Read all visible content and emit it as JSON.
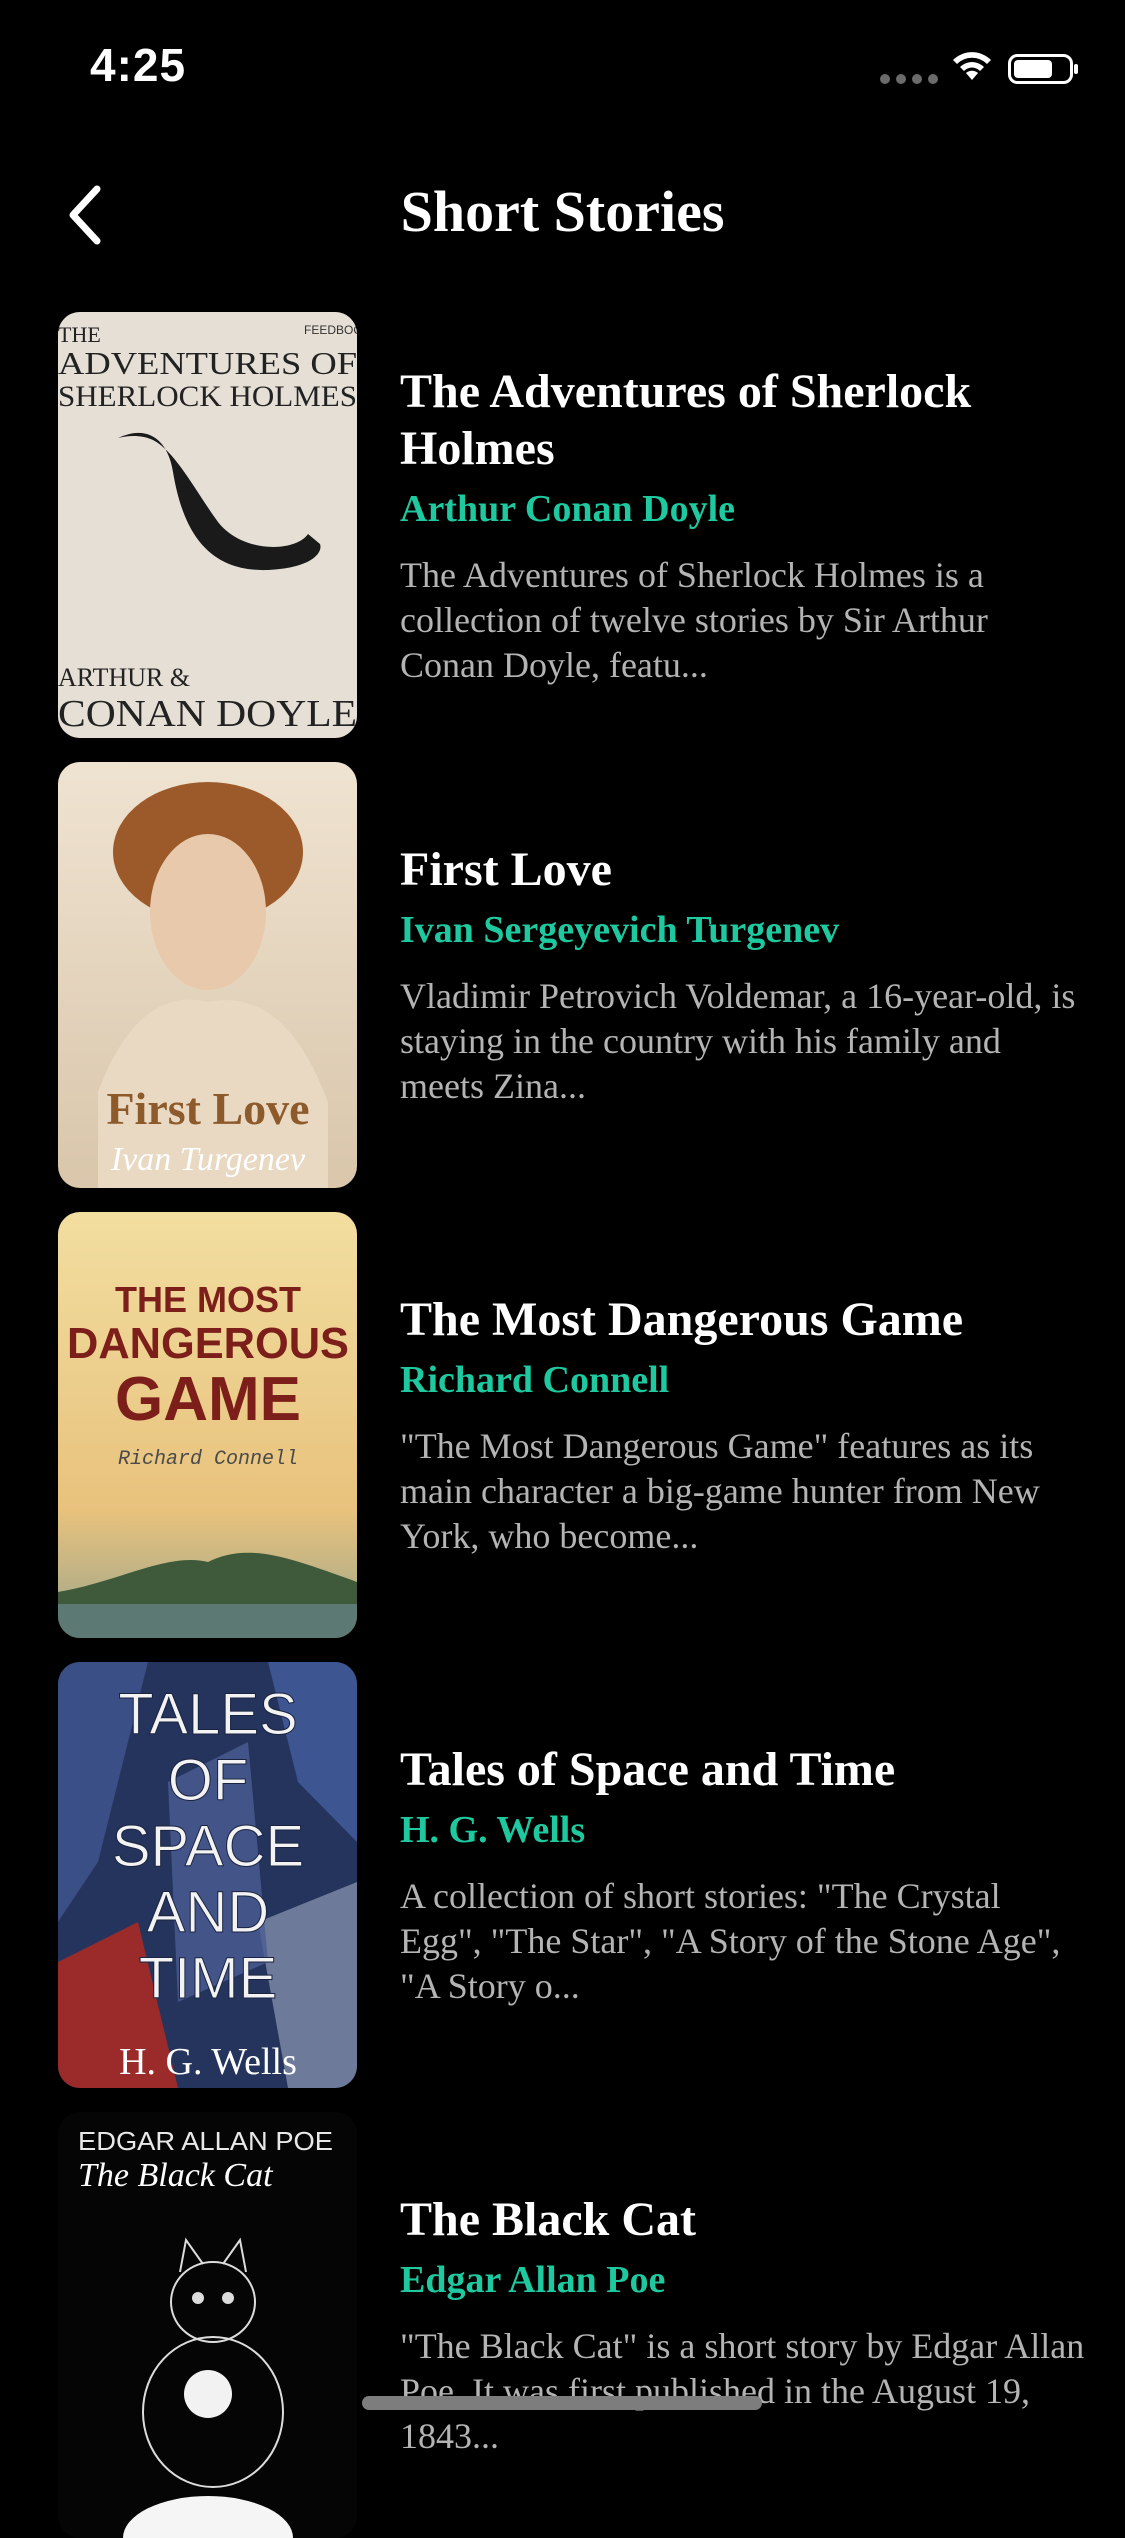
{
  "status_bar": {
    "time": "4:25",
    "signal_icon": "signal-dots-icon",
    "wifi_icon": "wifi-icon",
    "battery_icon": "battery-icon"
  },
  "nav": {
    "back_icon": "chevron-left-icon",
    "title": "Short Stories"
  },
  "colors": {
    "background": "#000000",
    "title": "#ffffff",
    "author": "#1ec9a0",
    "description": "#b4b4b4"
  },
  "books": [
    {
      "title": "The Adventures of Sherlock Holmes",
      "author": "Arthur Conan Doyle",
      "description": "The Adventures of Sherlock Holmes is a collection of twelve stories by Sir Arthur Conan Doyle, featu...",
      "cover": {
        "line1": "THE",
        "line2": "ADVENTURES OF",
        "line3": "SHERLOCK HOLMES",
        "publisher": "FEEDBOOKS",
        "author_line1": "ARTHUR &",
        "author_line2": "CONAN DOYLE"
      }
    },
    {
      "title": "First Love",
      "author": "Ivan Sergeyevich Turgenev",
      "description": "Vladimir Petrovich Voldemar, a 16-year-old, is staying in the country with his family and meets Zina...",
      "cover": {
        "title": "First Love",
        "author": "Ivan Turgenev"
      }
    },
    {
      "title": "The Most Dangerous Game",
      "author": "Richard Connell",
      "description": "\"The Most Dangerous Game\" features as its main character a big-game hunter from New York, who become...",
      "cover": {
        "line1": "THE MOST",
        "line2": "DANGEROUS",
        "line3": "GAME",
        "author": "Richard Connell"
      }
    },
    {
      "title": "Tales of Space and Time",
      "author": "H. G. Wells",
      "description": "A collection of short stories: \"The Crystal Egg\", \"The Star\", \"A Story of the Stone Age\", \"A Story o...",
      "cover": {
        "line1": "TALES",
        "line2": "OF",
        "line3": "SPACE",
        "line4": "AND",
        "line5": "TIME",
        "author": "H. G. Wells"
      }
    },
    {
      "title": "The Black Cat",
      "author": "Edgar Allan Poe",
      "description": "\"The Black Cat\" is a short story by Edgar Allan Poe. It was first published in the August 19, 1843...",
      "cover": {
        "author": "EDGAR ALLAN POE",
        "title": "The Black Cat"
      }
    }
  ]
}
